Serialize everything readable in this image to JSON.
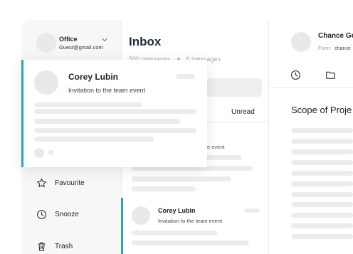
{
  "account": {
    "name": "Office",
    "email": "Guest@gmail.com"
  },
  "nav": [
    {
      "label": "Favourite"
    },
    {
      "label": "Snooze"
    },
    {
      "label": "Trash"
    }
  ],
  "inbox": {
    "title": "Inbox",
    "count_messages": "500 messages",
    "count_new": "6 messages",
    "tab_unread": "Unread",
    "snippet": "e event"
  },
  "featured_mail": {
    "sender": "Corey Lubin",
    "subject": "Invitation to the team event"
  },
  "list_mail": {
    "sender": "Corey Lubin",
    "subject": "Invitation to the team event"
  },
  "reader": {
    "sender": "Chance Ge",
    "from_label": "From:",
    "from_value": "chance",
    "subject": "Scope of Proje"
  },
  "colors": {
    "accent": "#2fa4b8"
  },
  "icons": [
    "chevron-down-icon",
    "star-icon",
    "clock-icon",
    "trash-icon",
    "folder-icon"
  ]
}
